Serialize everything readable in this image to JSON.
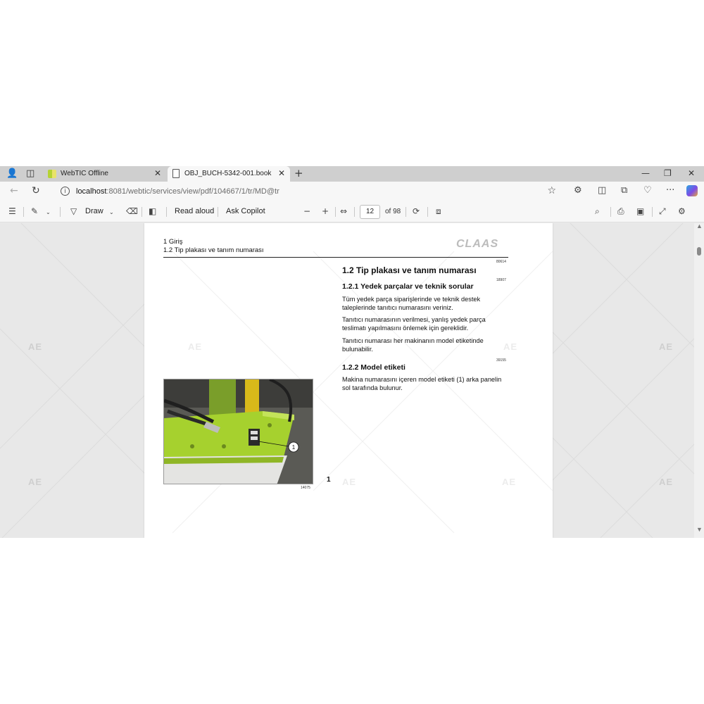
{
  "browser": {
    "tabs": [
      {
        "title": "WebTIC Offline"
      },
      {
        "title": "OBJ_BUCH-5342-001.book"
      }
    ],
    "new_tab": "+",
    "url_host": "localhost",
    "url_path": ":8081/webtic/services/view/pdf/104667/1/tr/MD@tr"
  },
  "pdf_toolbar": {
    "draw_label": "Draw",
    "read_aloud_label": "Read aloud",
    "ask_copilot_label": "Ask Copilot",
    "page_current": "12",
    "page_total": "of 98"
  },
  "document": {
    "header_chapter": "1 Giriş",
    "header_section": "1.2 Tip plakası ve tanım numarası",
    "logo": "CLAAS",
    "codes": [
      "80614",
      "18907",
      "39155"
    ],
    "heading_main": "1.2 Tip plakası ve tanım numarası",
    "heading_sub1": "1.2.1 Yedek parçalar ve teknik sorular",
    "para1": "Tüm yedek parça siparişlerinde ve teknik destek taleplerinde tanıtıcı numarasını veriniz.",
    "para2": "Tanıtıcı numarasının verilmesi, yanlış yedek parça teslimatı yapılmasını önlemek için gereklidir.",
    "para3": "Tanıtıcı numarası her makinanın model etiketinde bulunabilir.",
    "heading_sub2": "1.2.2 Model etiketi",
    "para4": "Makina numarasını içeren model etiketi (1) arka panelin sol tarafında bulunur.",
    "figure_callout": "1",
    "figure_number": "14075",
    "page_number": "1"
  },
  "watermark": "AE",
  "colors": {
    "tab_strip": "#cfcfcf",
    "toolbar": "#f7f7f7",
    "viewer_bg": "#e8e8e8",
    "machine_green": "#a6d12e"
  }
}
